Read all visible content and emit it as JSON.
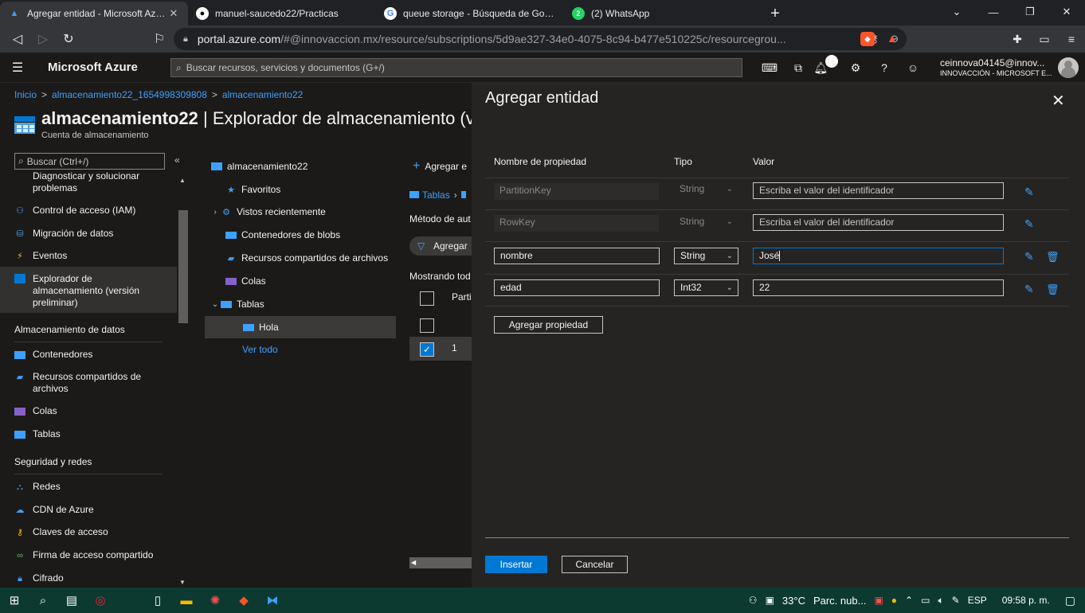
{
  "browser": {
    "tabs": [
      {
        "title": "Agregar entidad - Microsoft Azure",
        "icon": "azure-icon",
        "active": true
      },
      {
        "title": "manuel-saucedo22/Practicas",
        "icon": "github-icon",
        "active": false
      },
      {
        "title": "queue storage - Búsqueda de Google",
        "icon": "google-icon",
        "active": false
      },
      {
        "title": "(2) WhatsApp",
        "icon": "whatsapp-icon",
        "active": false
      }
    ],
    "url_host": "portal.azure.com",
    "url_path": "/#@innovaccion.mx/resource/subscriptions/5d9ae327-34e0-4075-8c94-b477e510225c/resourcegrou..."
  },
  "azure": {
    "brand": "Microsoft Azure",
    "search_placeholder": "Buscar recursos, servicios y documentos (G+/)",
    "notifications_count": "16",
    "account_user": "ceinnova04145@innov...",
    "account_org": "INNOVACCIÓN - MICROSOFT E..."
  },
  "breadcrumb": [
    "Inicio",
    "almacenamiento22_1654998309808",
    "almacenamiento22"
  ],
  "resource": {
    "name": "almacenamiento22",
    "title_rest": " | Explorador de almacenamiento (ve",
    "subtitle": "Cuenta de almacenamiento"
  },
  "leftnav": {
    "search_placeholder": "Buscar (Ctrl+/)",
    "items_top": [
      {
        "label": "Diagnosticar y solucionar problemas",
        "icon": "wrench-icon"
      },
      {
        "label": "Control de acceso (IAM)",
        "icon": "people-icon"
      },
      {
        "label": "Migración de datos",
        "icon": "database-icon"
      },
      {
        "label": "Eventos",
        "icon": "lightning-icon"
      },
      {
        "label": "Explorador de almacenamiento (versión preliminar)",
        "icon": "storage-explorer-icon"
      }
    ],
    "section_data": "Almacenamiento de datos",
    "items_data": [
      {
        "label": "Contenedores",
        "icon": "container-icon"
      },
      {
        "label": "Recursos compartidos de archivos",
        "icon": "file-share-icon"
      },
      {
        "label": "Colas",
        "icon": "queue-icon"
      },
      {
        "label": "Tablas",
        "icon": "table-icon"
      }
    ],
    "section_security": "Seguridad y redes",
    "items_security": [
      {
        "label": "Redes",
        "icon": "network-icon"
      },
      {
        "label": "CDN de Azure",
        "icon": "cloud-icon"
      },
      {
        "label": "Claves de acceso",
        "icon": "key-icon"
      },
      {
        "label": "Firma de acceso compartido",
        "icon": "link-icon"
      },
      {
        "label": "Cifrado",
        "icon": "lock-icon"
      }
    ]
  },
  "tree": {
    "root": "almacenamiento22",
    "items": [
      {
        "label": "Favoritos",
        "icon": "star-icon"
      },
      {
        "label": "Vistos recientemente",
        "icon": "gear-icon"
      },
      {
        "label": "Contenedores de blobs",
        "icon": "blob-icon"
      },
      {
        "label": "Recursos compartidos de archivos",
        "icon": "file-share-icon"
      },
      {
        "label": "Colas",
        "icon": "queue-icon"
      },
      {
        "label": "Tablas",
        "icon": "table-icon"
      },
      {
        "label": "Hola",
        "icon": "table-icon"
      }
    ],
    "see_all": "Ver todo"
  },
  "middle": {
    "toolbar_add": "Agregar e",
    "breadcrumb": "Tablas",
    "auth_label": "Método de aut",
    "filter_label": "Agregar",
    "showing": "Mostrando tod",
    "col_header": "Parti",
    "row_value": "1"
  },
  "blade": {
    "title": "Agregar entidad",
    "col_name": "Nombre de propiedad",
    "col_type": "Tipo",
    "col_value": "Valor",
    "rows": [
      {
        "name": "PartitionKey",
        "type": "String",
        "value": "",
        "placeholder": "Escriba el valor del identificador"
      },
      {
        "name": "RowKey",
        "type": "String",
        "value": "",
        "placeholder": "Escriba el valor del identificador"
      },
      {
        "name": "nombre",
        "type": "String",
        "value": "José",
        "placeholder": ""
      },
      {
        "name": "edad",
        "type": "Int32",
        "value": "22",
        "placeholder": ""
      }
    ],
    "add_property": "Agregar propiedad",
    "insert": "Insertar",
    "cancel": "Cancelar"
  },
  "taskbar": {
    "temperature": "33°C",
    "weather": "Parc. nub...",
    "language": "ESP",
    "time": "09:58 p. m."
  },
  "colors": {
    "accent": "#0078d4",
    "link": "#3ca1ff",
    "blade_bg": "#252423",
    "page_bg": "#1b1a19"
  }
}
